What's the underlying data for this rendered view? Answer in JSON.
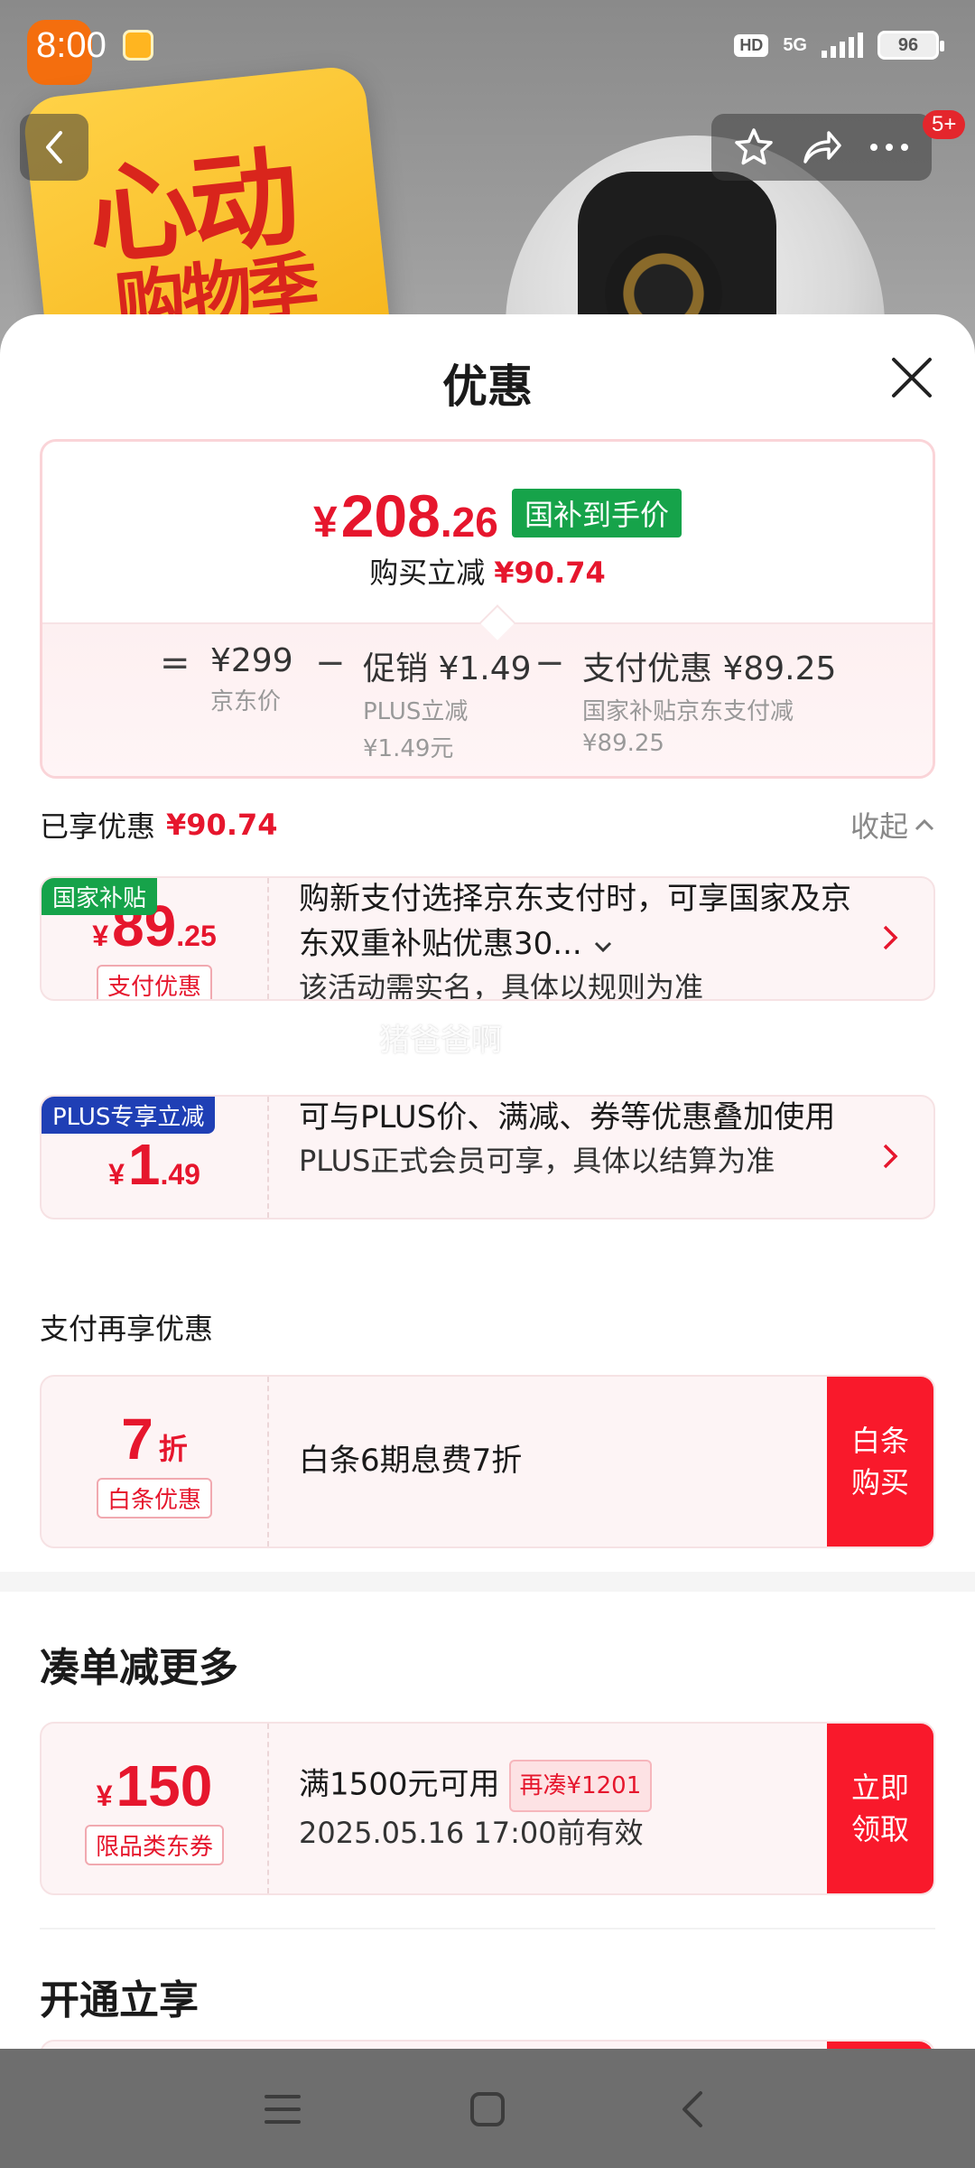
{
  "status_bar": {
    "time": "8:00",
    "hd": "HD",
    "network": "5G",
    "battery": "96"
  },
  "background": {
    "promo_line1": "心动",
    "promo_line2": "购物季",
    "notification_badge": "5+"
  },
  "sheet": {
    "title": "优惠",
    "price_summary": {
      "currency": "¥",
      "final_int": "208",
      "final_dec": ".26",
      "tag": "国补到手价",
      "reduce_label": "购买立减",
      "reduce_amount": "¥90.74",
      "equals": "=",
      "minus": "−",
      "jd_price": "¥299",
      "jd_price_label": "京东价",
      "promo_value": "促销 ¥1.49",
      "promo_label": "PLUS立减",
      "promo_sub": "¥1.49元",
      "pay_value": "支付优惠 ¥89.25",
      "pay_label": "国家补贴京东支付减",
      "pay_sub": "¥89.25"
    },
    "enjoyed": {
      "label": "已享优惠",
      "amount": "¥90.74",
      "collapse": "收起"
    },
    "offers": [
      {
        "tag": "国家补贴",
        "currency": "¥",
        "int": "89",
        "dec": ".25",
        "pill": "支付优惠",
        "desc": "购新支付选择京东支付时，可享国家及京东双重补贴优惠30...",
        "sub": "该活动需实名，具体以规则为准"
      },
      {
        "tag": "PLUS专享立减",
        "currency": "¥",
        "int": "1",
        "dec": ".49",
        "desc": "可与PLUS价、满减、券等优惠叠加使用",
        "sub": "PLUS正式会员可享，具体以结算为准"
      }
    ],
    "pay_more": {
      "title": "支付再享优惠",
      "value": "7",
      "unit": "折",
      "pill": "白条优惠",
      "desc": "白条6期息费7折",
      "action_line1": "白条",
      "action_line2": "购买"
    },
    "bundle": {
      "title": "凑单减更多",
      "currency": "¥",
      "value": "150",
      "pill": "限品类东券",
      "desc": "满1500元可用",
      "restock": "再凑¥1201",
      "validity": "2025.05.16 17:00前有效",
      "action_line1": "立即",
      "action_line2": "领取"
    },
    "open_title": "开通立享",
    "watermark": "猪爸爸啊"
  },
  "colors": {
    "accent_red": "#e6162d",
    "action_red": "#f9192b",
    "green_tag": "#16a34a",
    "plus_blue": "#1f3fb5"
  },
  "icons": [
    "back-icon",
    "star-icon",
    "share-icon",
    "more-icon",
    "close-icon",
    "chevron-up-icon",
    "chevron-down-icon",
    "chevron-right-icon",
    "menu-icon",
    "home-icon",
    "nav-back-icon"
  ]
}
